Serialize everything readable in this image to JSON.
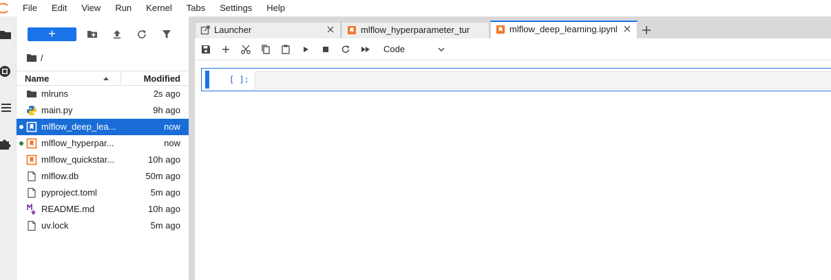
{
  "menubar": {
    "items": [
      "File",
      "Edit",
      "View",
      "Run",
      "Kernel",
      "Tabs",
      "Settings",
      "Help"
    ]
  },
  "filebrowser": {
    "new_button_label": "+",
    "breadcrumb": "/",
    "columns": {
      "name": "Name",
      "modified": "Modified"
    },
    "files": [
      {
        "name": "mlruns",
        "modified": "2s ago",
        "icon": "folder-icon",
        "selected": false,
        "status": null
      },
      {
        "name": "main.py",
        "modified": "9h ago",
        "icon": "python-icon",
        "selected": false,
        "status": null
      },
      {
        "name": "mlflow_deep_lea...",
        "modified": "now",
        "icon": "notebook-icon",
        "selected": true,
        "status": "open"
      },
      {
        "name": "mlflow_hyperpar...",
        "modified": "now",
        "icon": "notebook-icon",
        "selected": false,
        "status": "running"
      },
      {
        "name": "mlflow_quickstar...",
        "modified": "10h ago",
        "icon": "notebook-icon",
        "selected": false,
        "status": null
      },
      {
        "name": "mlflow.db",
        "modified": "50m ago",
        "icon": "file-icon",
        "selected": false,
        "status": null
      },
      {
        "name": "pyproject.toml",
        "modified": "5m ago",
        "icon": "file-icon",
        "selected": false,
        "status": null
      },
      {
        "name": "README.md",
        "modified": "10h ago",
        "icon": "markdown-icon",
        "selected": false,
        "status": null
      },
      {
        "name": "uv.lock",
        "modified": "5m ago",
        "icon": "file-icon",
        "selected": false,
        "status": null
      }
    ]
  },
  "tabs": [
    {
      "label": "Launcher",
      "icon": "launcher-icon",
      "active": false
    },
    {
      "label": "mlflow_hyperparameter_tur",
      "icon": "notebook-icon",
      "active": false
    },
    {
      "label": "mlflow_deep_learning.ipynl",
      "icon": "notebook-icon",
      "active": true
    }
  ],
  "notebook": {
    "cell_type": "Code",
    "cell_prompt": "[ ]:"
  },
  "colors": {
    "accent": "#1a73e8",
    "selected_row": "#1a6dd7",
    "notebook_orange": "#f37626",
    "running_dot": "#2e8540",
    "markdown_purple": "#7b2ea8"
  }
}
